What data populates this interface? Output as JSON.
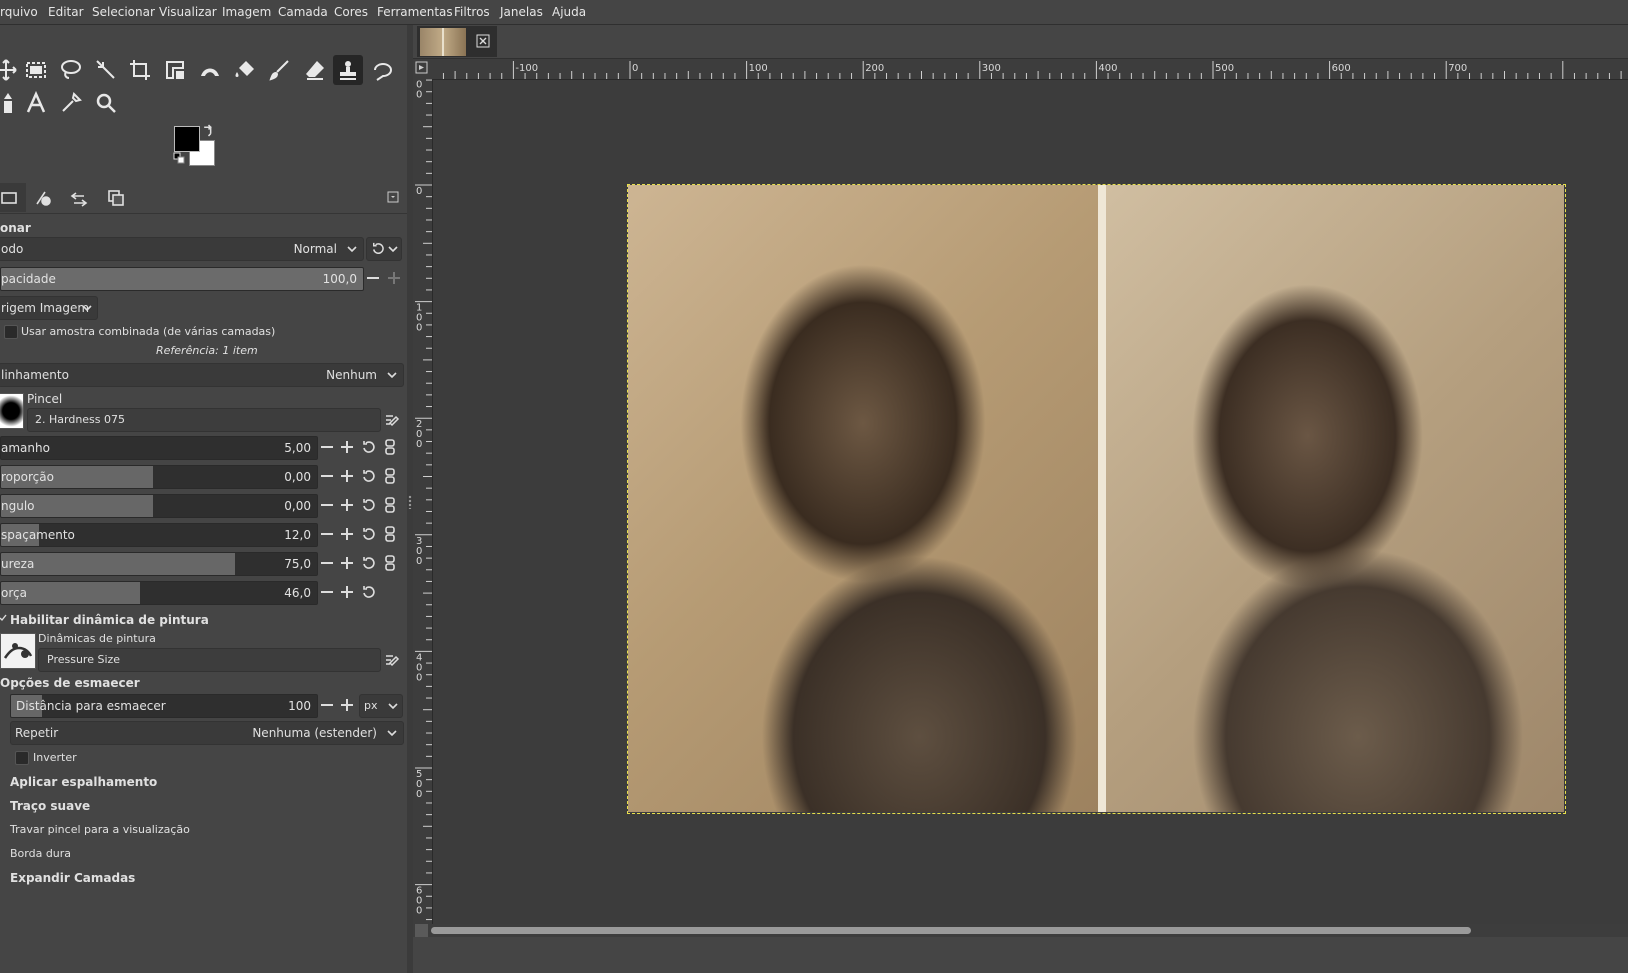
{
  "menu": [
    "rquivo",
    "Editar",
    "Selecionar",
    "Visualizar",
    "Imagem",
    "Camada",
    "Cores",
    "Ferramentas",
    "Filtros",
    "Janelas",
    "Ajuda"
  ],
  "tools_row1": [
    "move-icon",
    "rect-select-icon",
    "lasso-icon",
    "fuzzy-select-icon",
    "crop-icon",
    "transform-icon",
    "warp-icon",
    "bucket-fill-icon",
    "paintbrush-icon",
    "eraser-icon",
    "clone-stamp-icon",
    "smudge-icon"
  ],
  "tools_row2": [
    "path-icon",
    "text-icon",
    "color-picker-icon",
    "zoom-icon"
  ],
  "dock_tabs": [
    "tool-options-icon",
    "device-status-icon",
    "undo-history-icon",
    "images-icon"
  ],
  "options": {
    "section_title": "onar",
    "mode_label": "odo",
    "mode_value": "Normal",
    "opacity_label": "pacidade",
    "opacity_value": "100,0",
    "source_value": "rigem Imagem",
    "sample_merged_label": "Usar amostra combinada (de várias camadas)",
    "reference_text": "Referência: 1 item",
    "alignment_label": "linhamento",
    "alignment_value": "Nenhum",
    "brush_label": "Pincel",
    "brush_name": "2. Hardness 075",
    "sliders": [
      {
        "label": "amanho",
        "value": "5,00",
        "fill": 0.0
      },
      {
        "label": "roporção",
        "value": "0,00",
        "fill": 0.5
      },
      {
        "label": "ngulo",
        "value": "0,00",
        "fill": 0.5
      },
      {
        "label": "spaçamento",
        "value": "12,0",
        "fill": 0.12
      },
      {
        "label": "ureza",
        "value": "75,0",
        "fill": 0.75
      },
      {
        "label": "orça",
        "value": "46,0",
        "fill": 0.46
      }
    ],
    "dynamics_enable_label": "Habilitar dinâmica de pintura",
    "dynamics_label": "Dinâmicas de pintura",
    "dynamics_value": "Pressure Size",
    "fade_title": "Opções de esmaecer",
    "fade_distance_label": "Distância para esmaecer",
    "fade_distance_value": "100",
    "fade_unit": "px",
    "repeat_label": "Repetir",
    "repeat_value": "Nenhuma (estender)",
    "invert_label": "Inverter",
    "jitter_label": "Aplicar espalhamento",
    "smooth_label": "Traço suave",
    "lock_label": "Travar pincel para a visualização",
    "hard_edge_label": "Borda dura",
    "expand_label": "Expandir Camadas"
  },
  "hruler_labels": [
    "-100",
    "0",
    "100",
    "200",
    "300",
    "400",
    "500",
    "600",
    "700"
  ],
  "vruler_labels": [
    "1\n0\n0",
    "0",
    "1\n0\n0",
    "2\n0\n0",
    "3\n0\n0",
    "4\n0\n0",
    "5\n0\n0",
    "6\n0\n0"
  ],
  "colors": {
    "accent_selection": "#e7e04a",
    "fg": "#000000",
    "bg": "#ffffff"
  }
}
